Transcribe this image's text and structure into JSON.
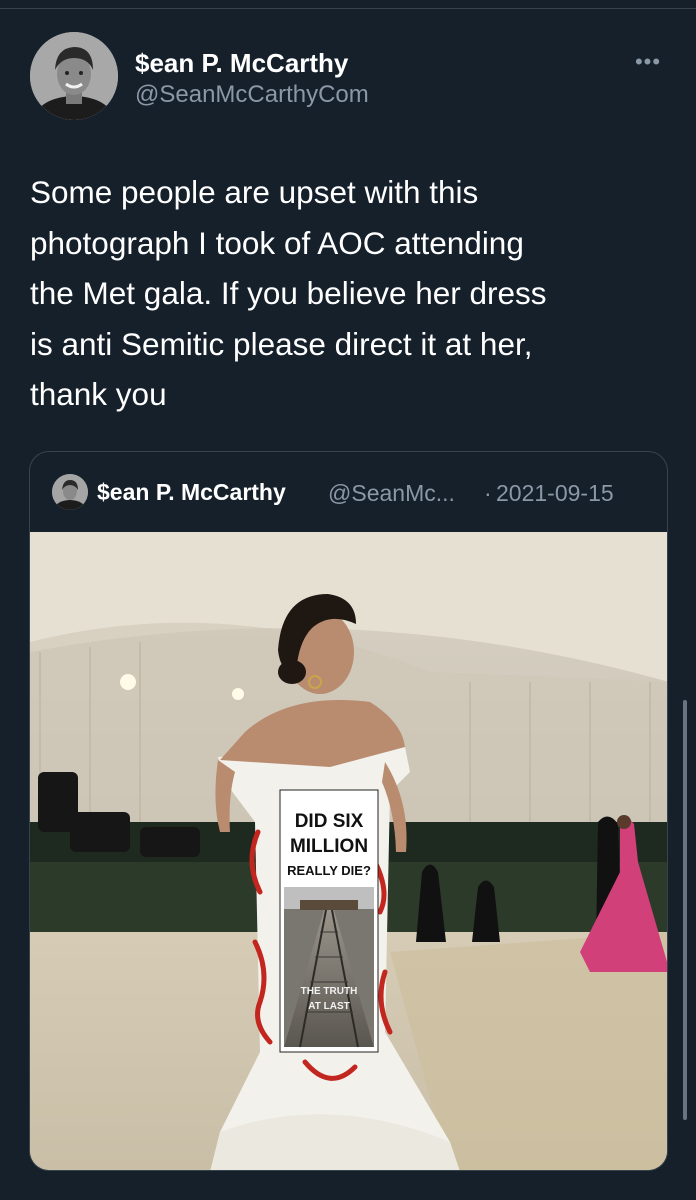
{
  "tweet": {
    "author": {
      "name": "$ean P. McCarthy",
      "handle": "@SeanMcCarthyCom"
    },
    "more_label": "•••",
    "text_lines": [
      "Some people are upset with this",
      "photograph I took of AOC attending",
      "the Met gala. If you believe her dress",
      "is anti Semitic please direct it at her,",
      "thank you"
    ]
  },
  "quoted": {
    "author_name": "$ean P. McCarthy",
    "author_handle": "@SeanMc...",
    "separator": "·",
    "date": "2021-09-15",
    "photo_sign": {
      "headline": [
        "DID SIX",
        "MILLION",
        "REALLY DIE?"
      ],
      "footer": [
        "THE TRUTH",
        "AT LAST"
      ]
    }
  },
  "colors": {
    "background": "#15202b",
    "text_primary": "#ffffff",
    "text_secondary": "#8b98a5",
    "border": "#38444d"
  }
}
